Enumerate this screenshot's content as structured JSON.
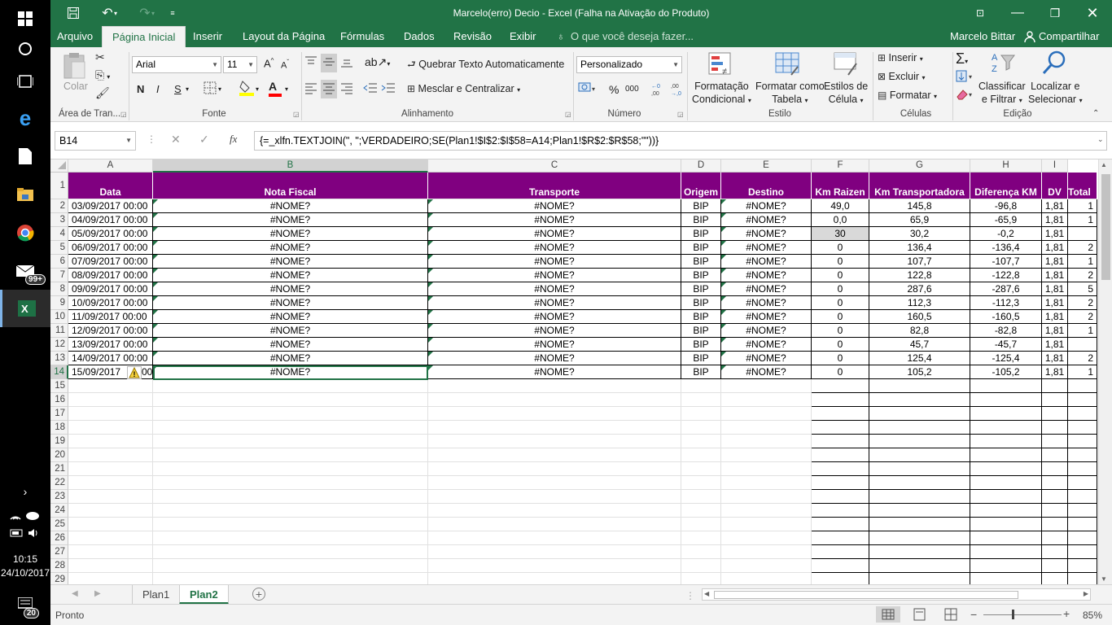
{
  "window": {
    "title": "Marcelo(erro) Decio  -  Excel (Falha na Ativação do Produto)"
  },
  "menu": {
    "tabs": [
      "Arquivo",
      "Página Inicial",
      "Inserir",
      "Layout da Página",
      "Fórmulas",
      "Dados",
      "Revisão",
      "Exibir"
    ],
    "tellme": "O que você deseja fazer...",
    "user": "Marcelo Bittar",
    "share": "Compartilhar"
  },
  "ribbon": {
    "clipboard": {
      "paste": "Colar",
      "label": "Área de Tran..."
    },
    "font": {
      "name": "Arial",
      "size": "11",
      "label": "Fonte",
      "bold": "N",
      "italic": "I",
      "underline": "S"
    },
    "alignment": {
      "wrap": "Quebrar Texto Automaticamente",
      "merge": "Mesclar e Centralizar",
      "label": "Alinhamento"
    },
    "number": {
      "format": "Personalizado",
      "label": "Número",
      "percent": "%",
      "thousands": "000"
    },
    "styles": {
      "cond1": "Formatação",
      "cond2": "Condicional",
      "table1": "Formatar como",
      "table2": "Tabela",
      "cell1": "Estilos de",
      "cell2": "Célula",
      "label": "Estilo"
    },
    "cells": {
      "insert": "Inserir",
      "delete": "Excluir",
      "format": "Formatar",
      "label": "Células"
    },
    "editing": {
      "sort1": "Classificar",
      "sort2": "e Filtrar",
      "find1": "Localizar e",
      "find2": "Selecionar",
      "label": "Edição"
    }
  },
  "formula_bar": {
    "name_box": "B14",
    "formula": "{=_xlfn.TEXTJOIN(\", \";VERDADEIRO;SE(Plan1!$I$2:$I$58=A14;Plan1!$R$2:$R$58;\"\"))}"
  },
  "grid": {
    "columns": [
      "A",
      "B",
      "C",
      "D",
      "E",
      "F",
      "G",
      "H",
      "I"
    ],
    "headers": [
      "Data",
      "Nota Fiscal",
      "Transporte",
      "Origem",
      "Destino",
      "Km Raizen",
      "Km Transportadora",
      "Diferença KM",
      "DV",
      "Total"
    ],
    "rows": [
      {
        "n": "2",
        "data": "03/09/2017 00:00",
        "nf": "#NOME?",
        "tr": "#NOME?",
        "or": "BIP",
        "de": "#NOME?",
        "kr": "49,0",
        "kt": "145,8",
        "dif": "-96,8",
        "dv": "1,81",
        "tot": "1"
      },
      {
        "n": "3",
        "data": "04/09/2017 00:00",
        "nf": "#NOME?",
        "tr": "#NOME?",
        "or": "BIP",
        "de": "#NOME?",
        "kr": "0,0",
        "kt": "65,9",
        "dif": "-65,9",
        "dv": "1,81",
        "tot": "1"
      },
      {
        "n": "4",
        "data": "05/09/2017 00:00",
        "nf": "#NOME?",
        "tr": "#NOME?",
        "or": "BIP",
        "de": "#NOME?",
        "kr": "30",
        "kt": "30,2",
        "dif": "-0,2",
        "dv": "1,81",
        "tot": ""
      },
      {
        "n": "5",
        "data": "06/09/2017 00:00",
        "nf": "#NOME?",
        "tr": "#NOME?",
        "or": "BIP",
        "de": "#NOME?",
        "kr": "0",
        "kt": "136,4",
        "dif": "-136,4",
        "dv": "1,81",
        "tot": "2"
      },
      {
        "n": "6",
        "data": "07/09/2017 00:00",
        "nf": "#NOME?",
        "tr": "#NOME?",
        "or": "BIP",
        "de": "#NOME?",
        "kr": "0",
        "kt": "107,7",
        "dif": "-107,7",
        "dv": "1,81",
        "tot": "1"
      },
      {
        "n": "7",
        "data": "08/09/2017 00:00",
        "nf": "#NOME?",
        "tr": "#NOME?",
        "or": "BIP",
        "de": "#NOME?",
        "kr": "0",
        "kt": "122,8",
        "dif": "-122,8",
        "dv": "1,81",
        "tot": "2"
      },
      {
        "n": "8",
        "data": "09/09/2017 00:00",
        "nf": "#NOME?",
        "tr": "#NOME?",
        "or": "BIP",
        "de": "#NOME?",
        "kr": "0",
        "kt": "287,6",
        "dif": "-287,6",
        "dv": "1,81",
        "tot": "5"
      },
      {
        "n": "9",
        "data": "10/09/2017 00:00",
        "nf": "#NOME?",
        "tr": "#NOME?",
        "or": "BIP",
        "de": "#NOME?",
        "kr": "0",
        "kt": "112,3",
        "dif": "-112,3",
        "dv": "1,81",
        "tot": "2"
      },
      {
        "n": "10",
        "data": "11/09/2017 00:00",
        "nf": "#NOME?",
        "tr": "#NOME?",
        "or": "BIP",
        "de": "#NOME?",
        "kr": "0",
        "kt": "160,5",
        "dif": "-160,5",
        "dv": "1,81",
        "tot": "2"
      },
      {
        "n": "11",
        "data": "12/09/2017 00:00",
        "nf": "#NOME?",
        "tr": "#NOME?",
        "or": "BIP",
        "de": "#NOME?",
        "kr": "0",
        "kt": "82,8",
        "dif": "-82,8",
        "dv": "1,81",
        "tot": "1"
      },
      {
        "n": "12",
        "data": "13/09/2017 00:00",
        "nf": "#NOME?",
        "tr": "#NOME?",
        "or": "BIP",
        "de": "#NOME?",
        "kr": "0",
        "kt": "45,7",
        "dif": "-45,7",
        "dv": "1,81",
        "tot": ""
      },
      {
        "n": "13",
        "data": "14/09/2017 00:00",
        "nf": "#NOME?",
        "tr": "#NOME?",
        "or": "BIP",
        "de": "#NOME?",
        "kr": "0",
        "kt": "125,4",
        "dif": "-125,4",
        "dv": "1,81",
        "tot": "2"
      },
      {
        "n": "14",
        "data": "15/09/2017",
        "nf": "#NOME?",
        "tr": "#NOME?",
        "or": "BIP",
        "de": "#NOME?",
        "kr": "0",
        "kt": "105,2",
        "dif": "-105,2",
        "dv": "1,81",
        "tot": "1"
      }
    ],
    "row14_tail": "00",
    "empty_rows": [
      "15",
      "16",
      "17",
      "18",
      "19",
      "20",
      "21",
      "22",
      "23",
      "24",
      "25",
      "26",
      "27",
      "28",
      "29"
    ],
    "header_row": "1",
    "header_color": "#800080"
  },
  "sheets": [
    "Plan1",
    "Plan2"
  ],
  "status": {
    "mode": "Pronto",
    "zoom": "85%"
  },
  "taskbar": {
    "time": "10:15",
    "date": "24/10/2017",
    "mail_badge": "99+",
    "notif_badge": "20"
  }
}
